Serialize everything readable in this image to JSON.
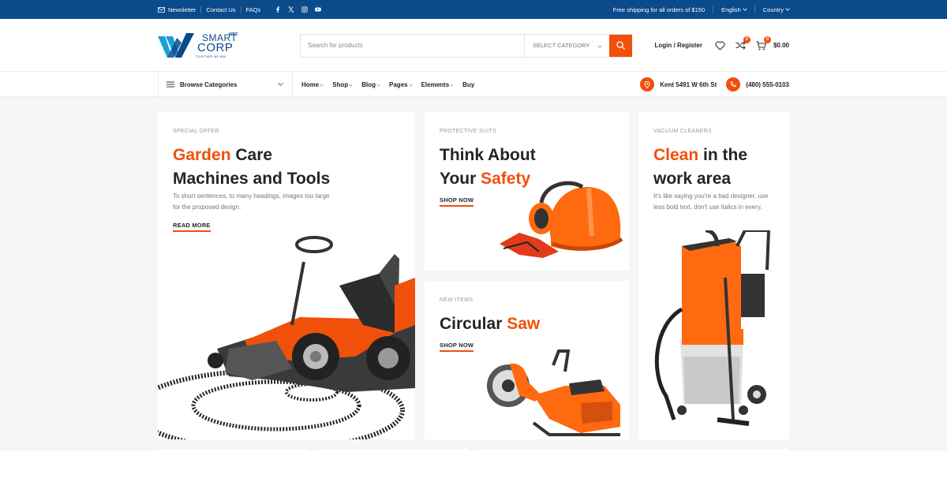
{
  "topbar": {
    "links": [
      "Newsletter",
      "Contact Us",
      "FAQs"
    ],
    "social_icons": [
      "facebook-icon",
      "x-icon",
      "instagram-icon",
      "youtube-icon"
    ],
    "shipping": "Free shipping for all orders of $150",
    "language": "English",
    "country": "Country"
  },
  "header": {
    "logo": {
      "line1": "SMART",
      "sup": "WSC",
      "line2": "CORP",
      "tagline": "TOGETHER WE WIN"
    },
    "search_placeholder": "Search for products",
    "category": "SELECT CATEGORY",
    "login": "Login / Register",
    "compare_count": "0",
    "cart_count": "0",
    "cart_total": "$0.00"
  },
  "nav": {
    "browse": "Browse Categories",
    "menu": [
      {
        "label": "Home",
        "dropdown": true
      },
      {
        "label": "Shop",
        "dropdown": true
      },
      {
        "label": "Blog",
        "dropdown": true
      },
      {
        "label": "Pages",
        "dropdown": true
      },
      {
        "label": "Elements",
        "dropdown": true
      },
      {
        "label": "Buy",
        "dropdown": false
      }
    ],
    "address": "Kent 5491 W 6th St",
    "phone": "(480) 555-0103"
  },
  "cards": [
    {
      "kicker": "SPECIAL OFFER",
      "title_hl": "Garden",
      "title_rest": " Care",
      "title_line2": "Machines and Tools",
      "desc": "To short sentences, to many headings, images too large for the proposed design.",
      "cta": "READ MORE"
    },
    {
      "kicker": "PROTECTIVE SUITS",
      "title_line1": "Think About",
      "title_pre": "Your ",
      "title_hl": "Safety",
      "cta": "SHOP NOW"
    },
    {
      "kicker": "NEW ITEMS",
      "title_pre": "Circular ",
      "title_hl": "Saw",
      "cta": "SHOP NOW"
    },
    {
      "kicker": "VACUUM CLEANERS",
      "title_hl": "Clean",
      "title_rest": " in the",
      "title_line2": "work area",
      "desc": "It's like saying you're a bad designer, use less bold text, don't use italics in every."
    }
  ],
  "colors": {
    "brand_blue": "#0b4a8b",
    "accent": "#f0500a"
  }
}
